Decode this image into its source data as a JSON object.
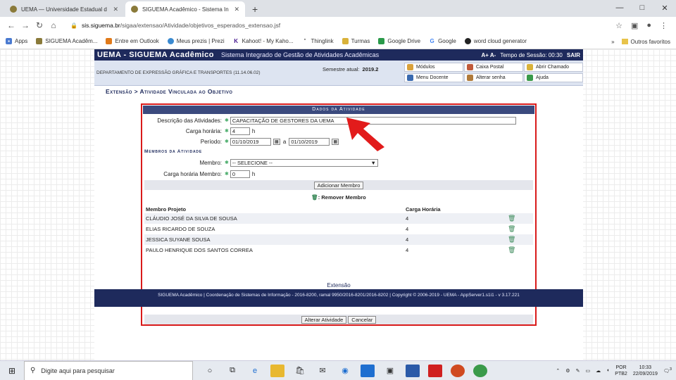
{
  "browser": {
    "tabs": [
      {
        "title": "UEMA — Universidade Estadual d",
        "active": false
      },
      {
        "title": "SIGUEMA Acadêmico - Sistema In",
        "active": true
      }
    ],
    "new_tab": "+",
    "window_controls": [
      "—",
      "□",
      "✕"
    ],
    "url_host": "sis.siguema.br",
    "url_path": "/sigaa/extensao/Atividade/objetivos_esperados_extensao.jsf",
    "bookmarks": [
      "Apps",
      "SIGUEMA Acadêm...",
      "Entre em Outlook",
      "Meus prezis | Prezi",
      "Kahoot! - My Kaho...",
      "Thinglink",
      "Turmas",
      "Google Drive",
      "Google",
      "word cloud generator"
    ],
    "bookmarks_more": "»",
    "other_favorites": "Outros favoritos"
  },
  "sig": {
    "brand": "UEMA - SIGUEMA Acadêmico",
    "subtitle": "Sistema Integrado de Gestão de Atividades Acadêmicas",
    "font_controls": "A+  A-",
    "session": "Tempo de Sessão: 00:30",
    "logout": "SAIR",
    "department": "DEPARTAMENTO DE EXPRESSÃO GRÁFICA E TRANSPORTES (11.14.06.02)",
    "semester_label": "Semestre atual:",
    "semester_value": "2019.2",
    "menu": [
      {
        "label": "Módulos",
        "icon": "modules-icon",
        "color": "#d9a13a"
      },
      {
        "label": "Caixa Postal",
        "icon": "mailbox-icon",
        "color": "#c05a3a"
      },
      {
        "label": "Abrir Chamado",
        "icon": "ticket-icon",
        "color": "#d9b23a"
      },
      {
        "label": "Menu Docente",
        "icon": "teacher-menu-icon",
        "color": "#3a6ab0"
      },
      {
        "label": "Alterar senha",
        "icon": "key-icon",
        "color": "#b07a3a"
      },
      {
        "label": "Ajuda",
        "icon": "help-icon",
        "color": "#3a9a4a"
      }
    ],
    "breadcrumb": "Extensão > Atividade Vinculada ao Objetivo"
  },
  "form": {
    "title": "Dados da Atividade",
    "descricao_label": "Descrição das Atividades:",
    "descricao_value": "CAPACITAÇÃO DE GESTORES DA UEMA",
    "carga_label": "Carga horária:",
    "carga_value": "4",
    "carga_unit": "h",
    "periodo_label": "Período:",
    "periodo_inicio": "01/10/2019",
    "periodo_sep": "a",
    "periodo_fim": "01/10/2019",
    "membros_section": "Membros da Atividade",
    "membro_label": "Membro:",
    "membro_select": "-- SELECIONE --",
    "carga_membro_label": "Carga horária Membro:",
    "carga_membro_value": "0",
    "carga_membro_unit": "h",
    "add_button": "Adicionar Membro",
    "remove_legend": ": Remover Membro",
    "table_headers": [
      "Membro Projeto",
      "Carga Horária"
    ],
    "members": [
      {
        "name": "CLÁUDIO JOSÉ DA SILVA DE SOUSA",
        "hours": "4"
      },
      {
        "name": "ELIAS RICARDO DE SOUZA",
        "hours": "4"
      },
      {
        "name": "JESSICA SUYANE SOUSA",
        "hours": "4"
      },
      {
        "name": "PAULO HENRIQUE DOS SANTOS CORREA",
        "hours": "4"
      }
    ],
    "save_button": "Alterar Atividade",
    "cancel_button": "Cancelar",
    "highlight_color": "#d91a1a"
  },
  "footer": {
    "link": "Extensão",
    "text": "SIGUEMA Acadêmico | Coordenação de Sistemas de Informação - 2016-8200, ramal 9950/2016-8201/2016-8202 | Copyright © 2006-2019 - UEMA - AppServer1.s1i1 - v 3.17.221"
  },
  "taskbar": {
    "search_placeholder": "Digite aqui para pesquisar",
    "lang": "POR",
    "lang2": "PTB2",
    "time": "10:33",
    "date": "22/09/2019",
    "notifications": "3"
  }
}
